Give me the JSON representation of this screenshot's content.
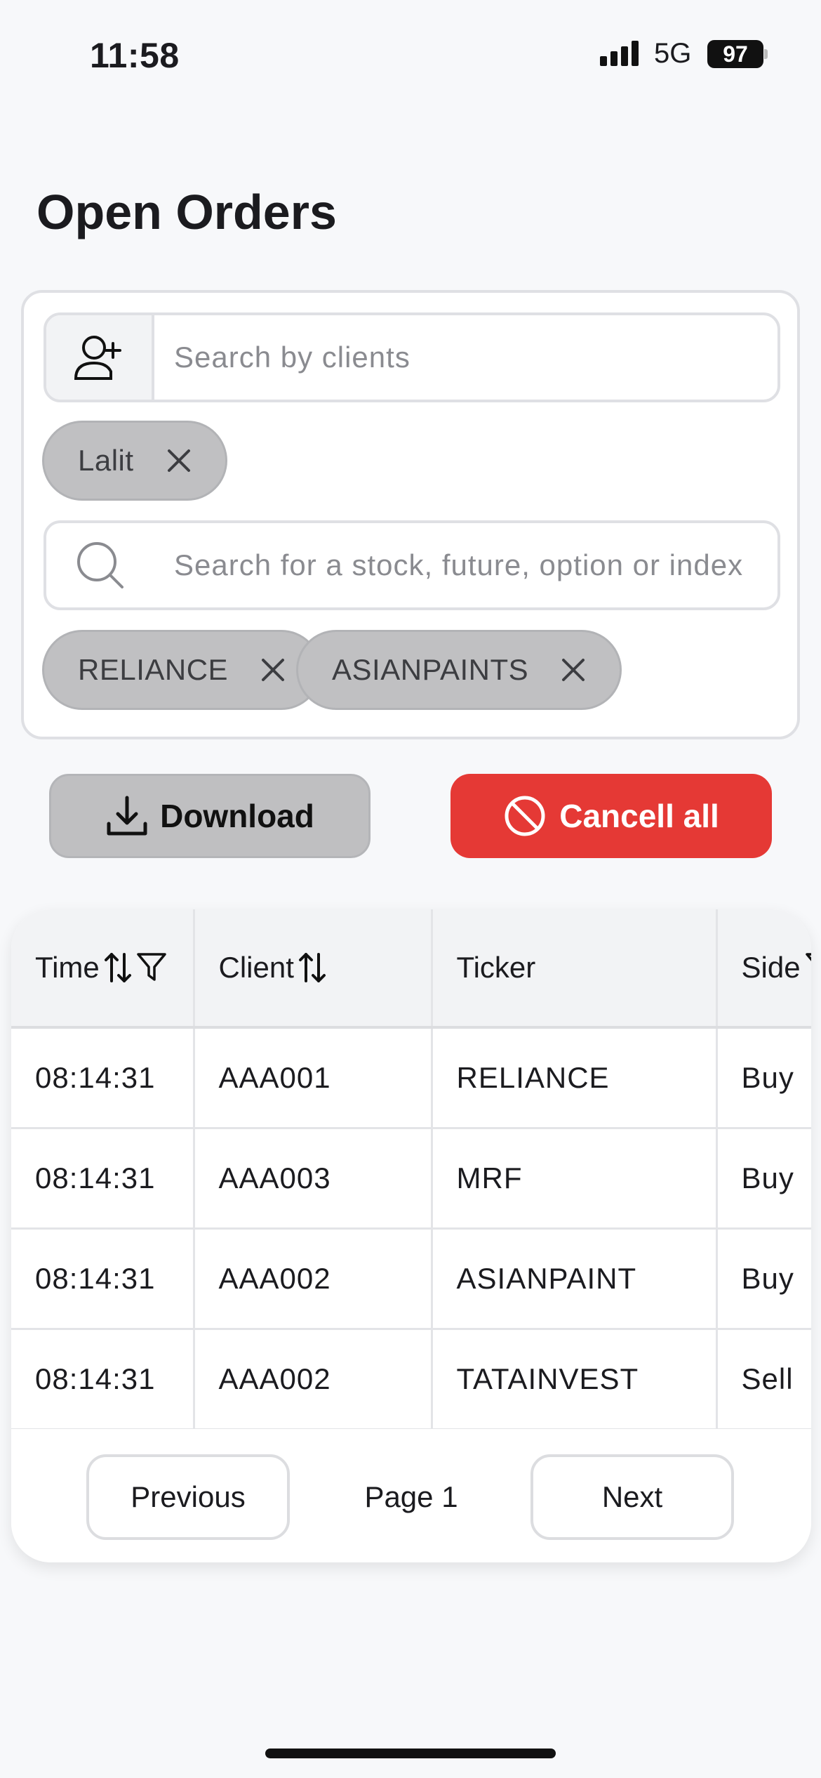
{
  "status_bar": {
    "time": "11:58",
    "network": "5G",
    "battery": "97"
  },
  "page": {
    "title": "Open Orders"
  },
  "filters": {
    "client_search": {
      "placeholder": "Search by clients",
      "value": ""
    },
    "client_chips": [
      {
        "label": "Lalit"
      }
    ],
    "stock_search": {
      "placeholder": "Search for a stock, future, option or index",
      "value": ""
    },
    "stock_chips": [
      {
        "label": "RELIANCE"
      },
      {
        "label": "ASIANPAINTS"
      }
    ]
  },
  "actions": {
    "download_label": "Download",
    "cancel_all_label": "Cancell all"
  },
  "table": {
    "columns": [
      {
        "label": "Time",
        "sortable": true,
        "filterable": true
      },
      {
        "label": "Client",
        "sortable": true,
        "filterable": false
      },
      {
        "label": "Ticker",
        "sortable": false,
        "filterable": false
      },
      {
        "label": "Side",
        "sortable": false,
        "filterable": true
      }
    ],
    "rows": [
      {
        "time": "08:14:31",
        "client": "AAA001",
        "ticker": "RELIANCE",
        "side": "Buy"
      },
      {
        "time": "08:14:31",
        "client": "AAA003",
        "ticker": "MRF",
        "side": "Buy"
      },
      {
        "time": "08:14:31",
        "client": "AAA002",
        "ticker": "ASIANPAINT",
        "side": "Buy"
      },
      {
        "time": "08:14:31",
        "client": "AAA002",
        "ticker": "TATAINVEST",
        "side": "Sell"
      }
    ]
  },
  "pagination": {
    "previous_label": "Previous",
    "page_label": "Page 1",
    "next_label": "Next"
  },
  "colors": {
    "accent_danger": "#e53935",
    "chip_bg": "#c0c0c2",
    "background": "#f7f8fa"
  },
  "icons": {
    "client": "add-user-icon",
    "stock": "search-icon",
    "chip_remove": "close-icon",
    "download": "download-icon",
    "cancel": "ban-icon",
    "sort": "sort-icon",
    "filter": "filter-icon"
  }
}
